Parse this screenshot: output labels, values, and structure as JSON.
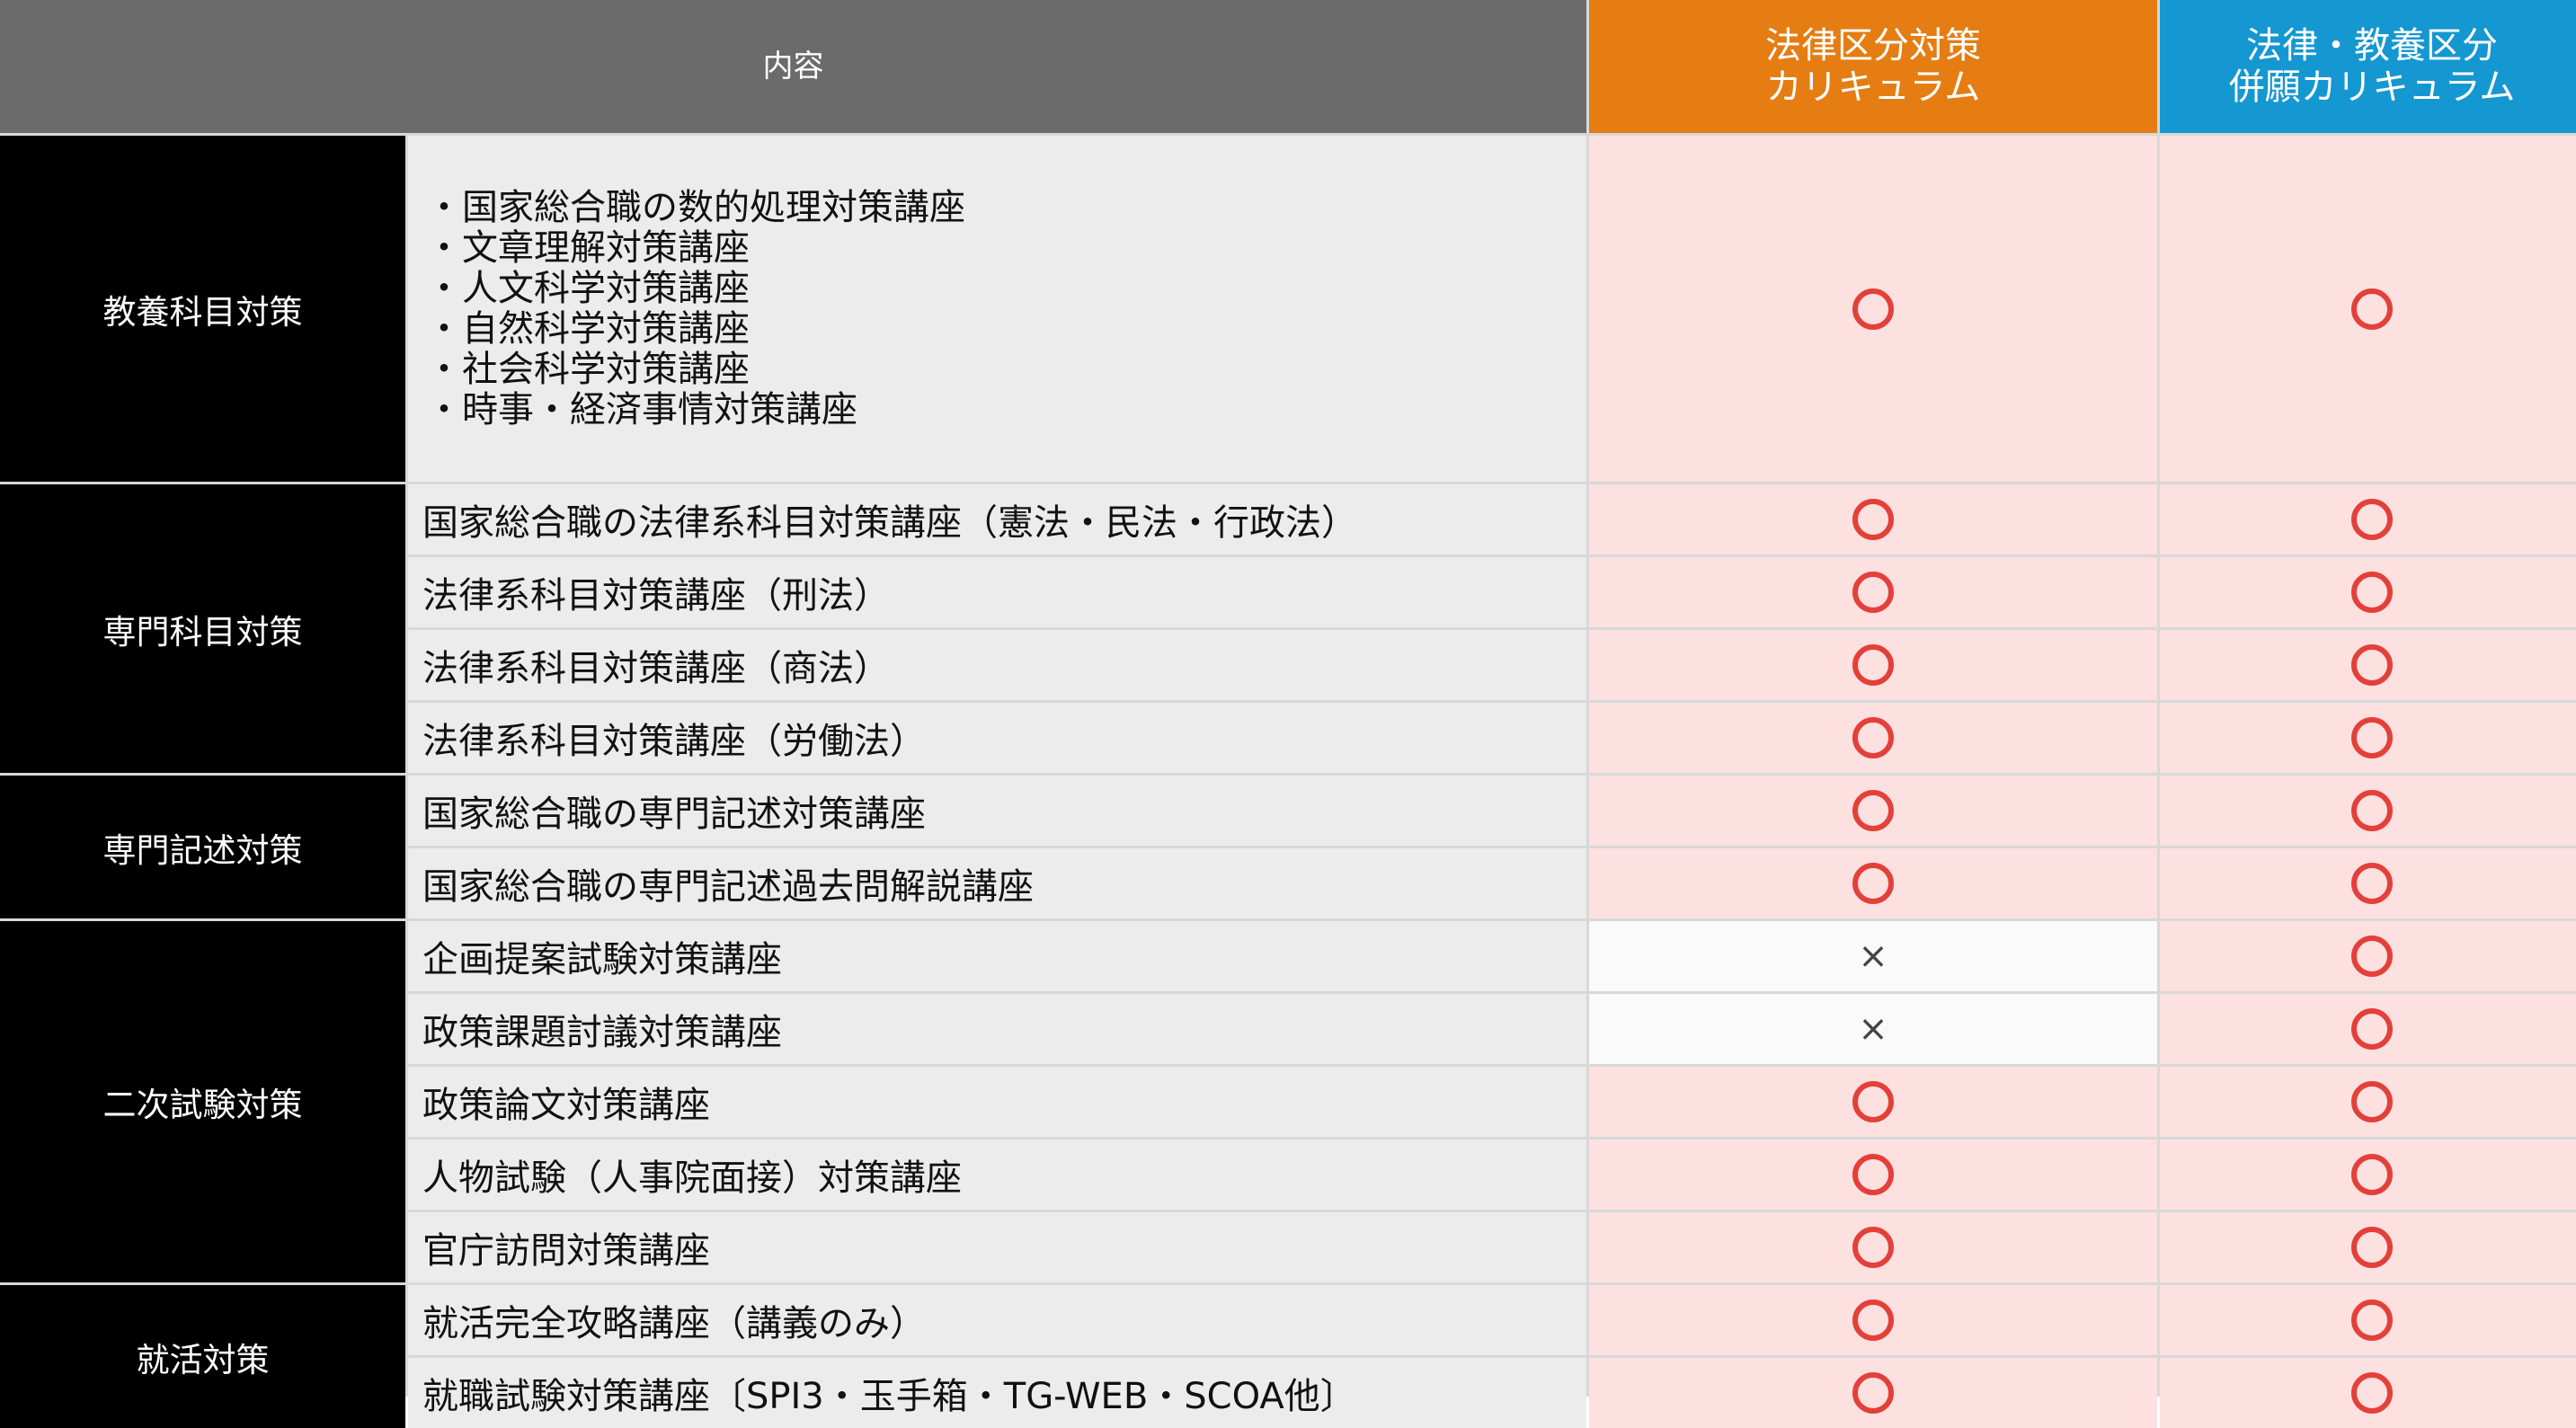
{
  "header": {
    "content": "内容",
    "col_a_line1": "法律区分対策",
    "col_a_line2": "カリキュラム",
    "col_b_line1": "法律・教養区分",
    "col_b_line2": "併願カリキュラム"
  },
  "categories": {
    "general": "教養科目対策",
    "specialized": "専門科目対策",
    "descriptive": "専門記述対策",
    "second_exam": "二次試験対策",
    "job_hunting": "就活対策"
  },
  "general_items": [
    "・国家総合職の数的処理対策講座",
    "・文章理解対策講座",
    "・人文科学対策講座",
    "・自然科学対策講座",
    "・社会科学対策講座",
    "・時事・経済事情対策講座"
  ],
  "rows": [
    {
      "label": "国家総合職の法律系科目対策講座（憲法・民法・行政法）",
      "a": "circle-icon",
      "b": "circle-icon"
    },
    {
      "label": "法律系科目対策講座（刑法）",
      "a": "circle-icon",
      "b": "circle-icon"
    },
    {
      "label": "法律系科目対策講座（商法）",
      "a": "circle-icon",
      "b": "circle-icon"
    },
    {
      "label": "法律系科目対策講座（労働法）",
      "a": "circle-icon",
      "b": "circle-icon"
    },
    {
      "label": "国家総合職の専門記述対策講座",
      "a": "circle-icon",
      "b": "circle-icon"
    },
    {
      "label": "国家総合職の専門記述過去問解説講座",
      "a": "circle-icon",
      "b": "circle-icon"
    },
    {
      "label": "企画提案試験対策講座",
      "a": "×",
      "b": "circle-icon"
    },
    {
      "label": "政策課題討議対策講座",
      "a": "×",
      "b": "circle-icon"
    },
    {
      "label": "政策論文対策講座",
      "a": "circle-icon",
      "b": "circle-icon"
    },
    {
      "label": "人物試験（人事院面接）対策講座",
      "a": "circle-icon",
      "b": "circle-icon"
    },
    {
      "label": "官庁訪問対策講座",
      "a": "circle-icon",
      "b": "circle-icon"
    },
    {
      "label": "就活完全攻略講座（講義のみ）",
      "a": "circle-icon",
      "b": "circle-icon"
    },
    {
      "label": "就職試験対策講座〔SPI3・玉手箱・TG-WEB・SCOA他〕",
      "a": "circle-icon",
      "b": "circle-icon"
    }
  ],
  "colors": {
    "header_content": "#6b6b6b",
    "header_a": "#e57d13",
    "header_b": "#1597d1",
    "mark_bg": "#fde0e0",
    "circle": "#e3403a"
  }
}
